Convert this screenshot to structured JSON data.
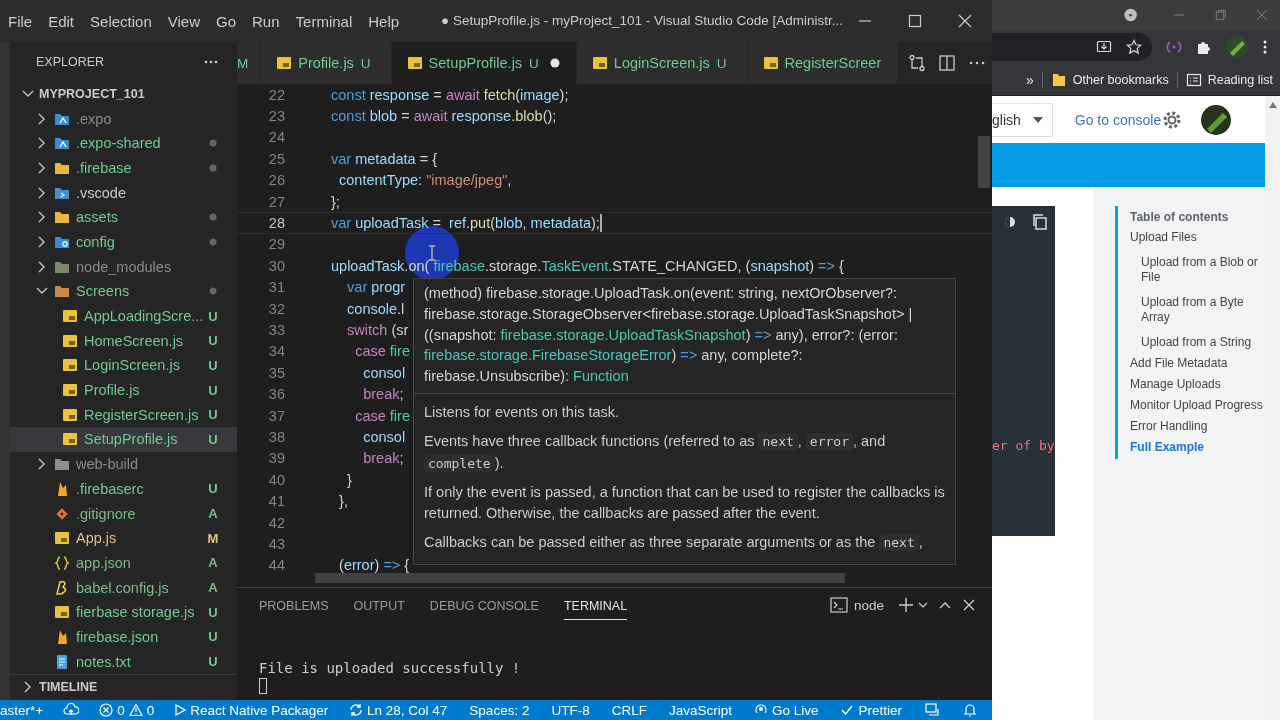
{
  "vscode": {
    "menu": [
      "File",
      "Edit",
      "Selection",
      "View",
      "Go",
      "Run",
      "Terminal",
      "Help"
    ],
    "title": "● SetupProfile.js - myProject_101 - Visual Studio Code [Administr...",
    "explorer": {
      "title": "EXPLORER",
      "project": {
        "label": "MYPROJECT_101",
        "expanded": true,
        "children": [
          {
            "label": ".expo",
            "kind": "folder-expo",
            "color": "#8c8c8c",
            "dot": false,
            "expanded": false,
            "selected": false
          },
          {
            "label": ".expo-shared",
            "kind": "folder-expo",
            "color": "#73c991",
            "dot": true,
            "expanded": false,
            "selected": false
          },
          {
            "label": ".firebase",
            "kind": "folder",
            "color": "#73c991",
            "dot": true,
            "expanded": false,
            "selected": false
          },
          {
            "label": ".vscode",
            "kind": "folder-vscode",
            "color": "#cccccc",
            "dot": false,
            "expanded": false,
            "selected": false
          },
          {
            "label": "assets",
            "kind": "folder",
            "color": "#73c991",
            "dot": true,
            "expanded": false,
            "selected": false
          },
          {
            "label": "config",
            "kind": "folder-config",
            "color": "#73c991",
            "dot": true,
            "expanded": false,
            "selected": false
          },
          {
            "label": "node_modules",
            "kind": "folder-node",
            "color": "#8c8c8c",
            "dot": false,
            "expanded": false,
            "selected": false
          },
          {
            "label": "Screens",
            "kind": "folder-screens",
            "color": "#73c991",
            "dot": true,
            "expanded": true,
            "selected": false,
            "children": [
              {
                "label": "AppLoadingScre...",
                "kind": "js",
                "color": "#73c991",
                "badge": "U",
                "dot": false,
                "selected": false
              },
              {
                "label": "HomeScreen.js",
                "kind": "js",
                "color": "#73c991",
                "badge": "U",
                "dot": false,
                "selected": false
              },
              {
                "label": "LoginScreen.js",
                "kind": "js",
                "color": "#73c991",
                "badge": "U",
                "dot": false,
                "selected": false
              },
              {
                "label": "Profile.js",
                "kind": "js",
                "color": "#73c991",
                "badge": "U",
                "dot": false,
                "selected": false
              },
              {
                "label": "RegisterScreen.js",
                "kind": "js",
                "color": "#73c991",
                "badge": "U",
                "dot": false,
                "selected": false
              },
              {
                "label": "SetupProfile.js",
                "kind": "js",
                "color": "#73c991",
                "badge": "U",
                "dot": false,
                "selected": true
              }
            ]
          },
          {
            "label": "web-build",
            "kind": "folder-web",
            "color": "#8c8c8c",
            "dot": false,
            "expanded": false,
            "selected": false
          },
          {
            "label": ".firebaserc",
            "kind": "flame",
            "color": "#73c991",
            "badge": "U",
            "dot": false,
            "selected": false
          },
          {
            "label": ".gitignore",
            "kind": "diamond",
            "color": "#81b88b",
            "badge": "A",
            "dot": false,
            "selected": false
          },
          {
            "label": "App.js",
            "kind": "js",
            "color": "#e2c08d",
            "badge": "M",
            "dot": false,
            "selected": false
          },
          {
            "label": "app.json",
            "kind": "braces",
            "color": "#81b88b",
            "badge": "A",
            "dot": false,
            "selected": false
          },
          {
            "label": "babel.config.js",
            "kind": "babel",
            "color": "#81b88b",
            "badge": "A",
            "dot": false,
            "selected": false
          },
          {
            "label": "fierbase storage.js",
            "kind": "js",
            "color": "#73c991",
            "badge": "U",
            "dot": false,
            "selected": false
          },
          {
            "label": "firebase.json",
            "kind": "flame",
            "color": "#73c991",
            "badge": "U",
            "dot": false,
            "selected": false
          },
          {
            "label": "notes.txt",
            "kind": "txt",
            "color": "#73c991",
            "badge": "U",
            "dot": false,
            "selected": false
          }
        ]
      },
      "timeline": {
        "label": "TIMELINE",
        "expanded": false
      }
    },
    "tabs": [
      {
        "badge": "M",
        "selected": false,
        "dirty": false
      },
      {
        "label": "Profile.js",
        "badge": "U",
        "selected": false,
        "dirty": false
      },
      {
        "label": "SetupProfile.js",
        "badge": "U",
        "selected": true,
        "dirty": true
      },
      {
        "label": "LoginScreen.js",
        "badge": "U",
        "selected": false,
        "dirty": false
      },
      {
        "label": "RegisterScreer",
        "selected": false,
        "dirty": false
      }
    ],
    "lines": [
      {
        "number": "22",
        "current": false,
        "tokens": [
          {
            "kind": "kw",
            "text": "const "
          },
          {
            "kind": "var",
            "text": "response"
          },
          {
            "kind": "p",
            "text": " = "
          },
          {
            "kind": "ctl",
            "text": "await "
          },
          {
            "kind": "fn",
            "text": "fetch"
          },
          {
            "kind": "p",
            "text": "("
          },
          {
            "kind": "var",
            "text": "image"
          },
          {
            "kind": "p",
            "text": ");"
          }
        ]
      },
      {
        "number": "23",
        "current": false,
        "tokens": [
          {
            "kind": "kw",
            "text": "const "
          },
          {
            "kind": "var",
            "text": "blob"
          },
          {
            "kind": "p",
            "text": " = "
          },
          {
            "kind": "ctl",
            "text": "await "
          },
          {
            "kind": "var",
            "text": "response"
          },
          {
            "kind": "p",
            "text": "."
          },
          {
            "kind": "fn",
            "text": "blob"
          },
          {
            "kind": "p",
            "text": "();"
          }
        ]
      },
      {
        "number": "24",
        "current": false
      },
      {
        "number": "25",
        "current": false,
        "tokens": [
          {
            "kind": "kw",
            "text": "var "
          },
          {
            "kind": "var",
            "text": "metadata"
          },
          {
            "kind": "p",
            "text": " = {"
          }
        ]
      },
      {
        "number": "26",
        "current": false,
        "tokens": [
          {
            "kind": "var",
            "text": "  contentType"
          },
          {
            "kind": "p",
            "text": ": "
          },
          {
            "kind": "str",
            "text": "\"image/jpeg\""
          },
          {
            "kind": "p",
            "text": ","
          }
        ]
      },
      {
        "number": "27",
        "current": false,
        "tokens": [
          {
            "kind": "p",
            "text": "};"
          }
        ]
      },
      {
        "number": "28",
        "current": true,
        "tokens": [
          {
            "kind": "kw",
            "text": "var "
          },
          {
            "kind": "var",
            "text": "uploadTask"
          },
          {
            "kind": "p",
            "text": " =  "
          },
          {
            "kind": "var",
            "text": "ref"
          },
          {
            "kind": "p",
            "text": "."
          },
          {
            "kind": "fn",
            "text": "put"
          },
          {
            "kind": "p",
            "text": "("
          },
          {
            "kind": "var",
            "text": "blob"
          },
          {
            "kind": "p",
            "text": ", "
          },
          {
            "kind": "var",
            "text": "metadata"
          },
          {
            "kind": "p",
            "text": ");"
          }
        ]
      },
      {
        "number": "29",
        "current": false
      },
      {
        "number": "30",
        "current": false,
        "tokens": [
          {
            "kind": "var",
            "text": "uploadTask"
          },
          {
            "kind": "p",
            "text": "."
          },
          {
            "kind": "fn",
            "text": "on"
          },
          {
            "kind": "p",
            "text": "( "
          },
          {
            "kind": "type",
            "text": "firebase"
          },
          {
            "kind": "p",
            "text": ".storage."
          },
          {
            "kind": "type",
            "text": "TaskEvent"
          },
          {
            "kind": "p",
            "text": ".STATE_CHANGED, ("
          },
          {
            "kind": "var",
            "text": "snapshot"
          },
          {
            "kind": "p",
            "text": ") "
          },
          {
            "kind": "kw",
            "text": "=>"
          },
          {
            "kind": "p",
            "text": " {"
          }
        ]
      },
      {
        "number": "31",
        "current": false,
        "tokens": [
          {
            "kind": "kw",
            "text": "    var "
          },
          {
            "kind": "var",
            "text": "progr"
          }
        ]
      },
      {
        "number": "32",
        "current": false,
        "tokens": [
          {
            "kind": "var",
            "text": "    console"
          },
          {
            "kind": "p",
            "text": ".l"
          }
        ]
      },
      {
        "number": "33",
        "current": false,
        "tokens": [
          {
            "kind": "ctl",
            "text": "    switch "
          },
          {
            "kind": "p",
            "text": "(sr"
          }
        ]
      },
      {
        "number": "34",
        "current": false,
        "tokens": [
          {
            "kind": "ctl",
            "text": "      case "
          },
          {
            "kind": "type",
            "text": "fire"
          }
        ]
      },
      {
        "number": "35",
        "current": false,
        "tokens": [
          {
            "kind": "var",
            "text": "        consol"
          }
        ]
      },
      {
        "number": "36",
        "current": false,
        "tokens": [
          {
            "kind": "ctl",
            "text": "        break"
          },
          {
            "kind": "p",
            "text": ";"
          }
        ]
      },
      {
        "number": "37",
        "current": false,
        "tokens": [
          {
            "kind": "ctl",
            "text": "      case "
          },
          {
            "kind": "type",
            "text": "fire"
          }
        ]
      },
      {
        "number": "38",
        "current": false,
        "tokens": [
          {
            "kind": "var",
            "text": "        consol"
          }
        ]
      },
      {
        "number": "39",
        "current": false,
        "tokens": [
          {
            "kind": "ctl",
            "text": "        break"
          },
          {
            "kind": "p",
            "text": ";"
          }
        ]
      },
      {
        "number": "40",
        "current": false,
        "tokens": [
          {
            "kind": "p",
            "text": "    }"
          }
        ]
      },
      {
        "number": "41",
        "current": false,
        "tokens": [
          {
            "kind": "p",
            "text": "  },"
          }
        ]
      },
      {
        "number": "42",
        "current": false
      },
      {
        "number": "43",
        "current": false
      },
      {
        "number": "44",
        "current": false,
        "tokens": [
          {
            "kind": "p",
            "text": "  ("
          },
          {
            "kind": "var",
            "text": "error"
          },
          {
            "kind": "p",
            "text": ") "
          },
          {
            "kind": "kw",
            "text": "=>"
          },
          {
            "kind": "p",
            "text": " {"
          }
        ]
      }
    ],
    "hover": {
      "signature": [
        {
          "kind": "p",
          "text": "(method) firebase.storage.UploadTask.on(event: string, nextOrObserver?: firebase.storage.StorageObserver<firebase.storage.UploadTaskSnapshot> | ((snapshot: "
        },
        {
          "kind": "type",
          "text": "firebase.storage.UploadTaskSnapshot"
        },
        {
          "kind": "p",
          "text": ") "
        },
        {
          "kind": "kw",
          "text": "=>"
        },
        {
          "kind": "p",
          "text": " any), error?: (error: "
        },
        {
          "kind": "type",
          "text": "firebase.storage.FirebaseStorageError"
        },
        {
          "kind": "p",
          "text": ") "
        },
        {
          "kind": "kw",
          "text": "=>"
        },
        {
          "kind": "p",
          "text": " any, complete?: firebase.Unsubscribe): "
        },
        {
          "kind": "type",
          "text": "Function"
        }
      ],
      "docs": [
        [
          {
            "kind": "t",
            "text": "Listens for events on this task."
          }
        ],
        [
          {
            "kind": "t",
            "text": "Events have three callback functions (referred to as "
          },
          {
            "kind": "code",
            "text": "next"
          },
          {
            "kind": "t",
            "text": ", "
          },
          {
            "kind": "code",
            "text": "error"
          },
          {
            "kind": "t",
            "text": ", and "
          },
          {
            "kind": "code",
            "text": "complete"
          },
          {
            "kind": "t",
            "text": ")."
          }
        ],
        [
          {
            "kind": "t",
            "text": "If only the event is passed, a function that can be used to register the callbacks is returned. Otherwise, the callbacks are passed after the event."
          }
        ],
        [
          {
            "kind": "t",
            "text": "Callbacks can be passed either as three separate arguments or as the "
          },
          {
            "kind": "code",
            "text": "next"
          },
          {
            "kind": "t",
            "text": ","
          }
        ]
      ]
    },
    "panel": {
      "tabs": [
        {
          "label": "PROBLEMS",
          "selected": false
        },
        {
          "label": "OUTPUT",
          "selected": false
        },
        {
          "label": "DEBUG CONSOLE",
          "selected": false
        },
        {
          "label": "TERMINAL",
          "selected": true
        }
      ],
      "shell": "node",
      "terminal_lines": [
        "File is uploaded successfully !"
      ]
    },
    "status_bar": {
      "left": [
        {
          "kind": "branch",
          "text": "aster*+"
        },
        {
          "kind": "publish"
        },
        {
          "kind": "problems",
          "errors": "0",
          "warnings": "0"
        },
        {
          "kind": "packager",
          "text": "React Native Packager"
        },
        {
          "kind": "sync"
        }
      ],
      "right": [
        {
          "kind": "text",
          "text": "Ln 28, Col 47"
        },
        {
          "kind": "text",
          "text": "Spaces: 2"
        },
        {
          "kind": "text",
          "text": "UTF-8"
        },
        {
          "kind": "text",
          "text": "CRLF"
        },
        {
          "kind": "text",
          "text": "JavaScript"
        },
        {
          "kind": "golive",
          "text": "Go Live"
        },
        {
          "kind": "prettier",
          "text": "Prettier"
        },
        {
          "kind": "feedback"
        },
        {
          "kind": "bell"
        }
      ]
    }
  },
  "browser": {
    "bookmarks": {
      "overflow": "»",
      "items": [
        {
          "kind": "folder",
          "label": "Other bookmarks"
        },
        {
          "kind": "reading",
          "label": "Reading list"
        }
      ]
    },
    "page": {
      "language": "glish",
      "console_link": "Go to console",
      "code_fragment": "er of by",
      "toc": {
        "title": "Table of contents",
        "items": [
          {
            "label": "Upload Files",
            "selected": false,
            "children": [
              {
                "label": "Upload from a Blob or File",
                "selected": false
              },
              {
                "label": "Upload from a Byte Array",
                "selected": false
              },
              {
                "label": "Upload from a String",
                "selected": false
              }
            ]
          },
          {
            "label": "Add File Metadata",
            "selected": false
          },
          {
            "label": "Manage Uploads",
            "selected": false
          },
          {
            "label": "Monitor Upload Progress",
            "selected": false
          },
          {
            "label": "Error Handling",
            "selected": false
          },
          {
            "label": "Full Example",
            "selected": true
          }
        ]
      }
    }
  }
}
